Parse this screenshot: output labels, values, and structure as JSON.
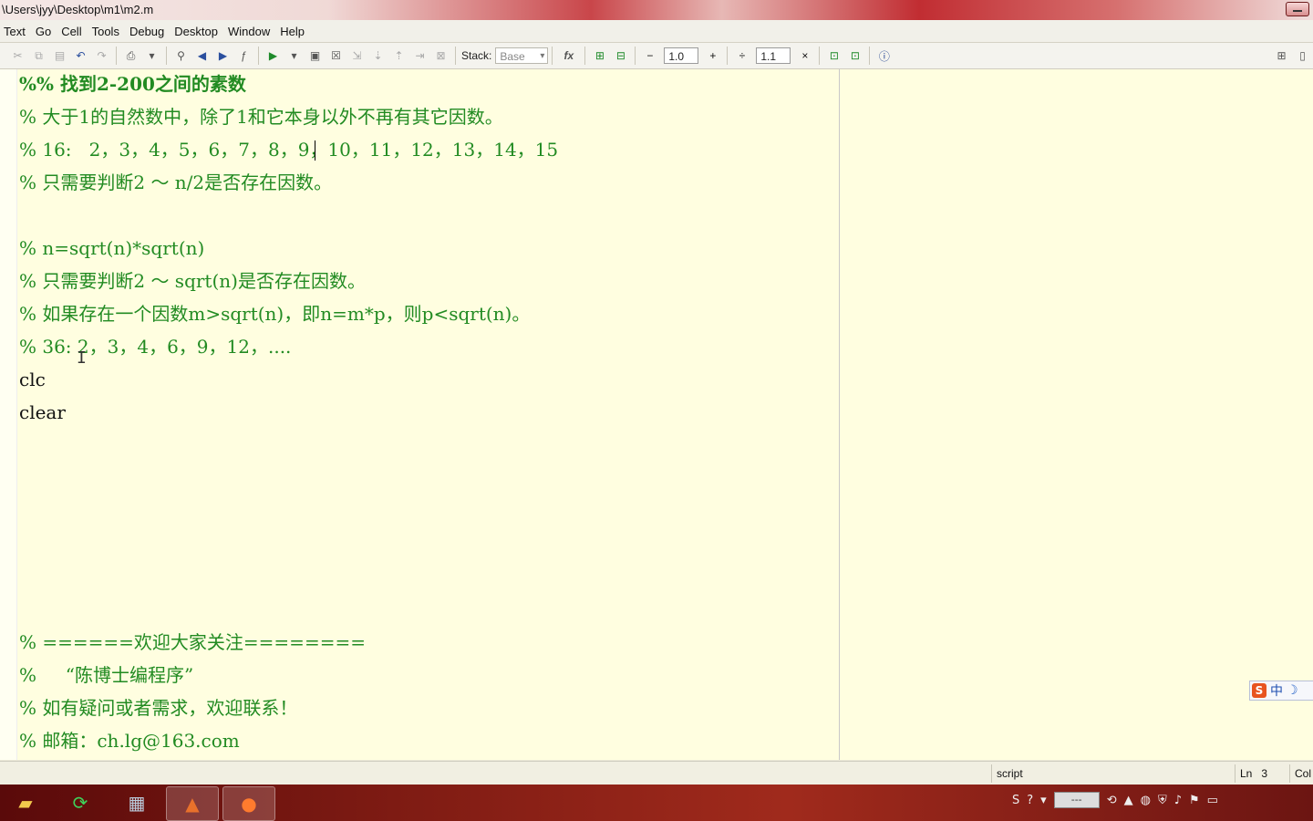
{
  "window": {
    "title_path": "\\Users\\jyy\\Desktop\\m1\\m2.m"
  },
  "menu": [
    "Text",
    "Go",
    "Cell",
    "Tools",
    "Debug",
    "Desktop",
    "Window",
    "Help"
  ],
  "toolbar": {
    "stack_label": "Stack:",
    "stack_value": "Base",
    "fx_label": "fx",
    "cell_increment": "1.0",
    "cell_divide": "1.1",
    "minus": "−",
    "plus": "+",
    "divide": "÷",
    "times": "×"
  },
  "editor": {
    "lines": [
      {
        "text": "%% 找到2-200之间的素数",
        "kind": "cell-title"
      },
      {
        "text": "% 大于1的自然数中，除了1和它本身以外不再有其它因数。",
        "kind": "comment"
      },
      {
        "text": "% 16:   2，3，4，5，6，7，8，9，10，11，12，13，14，15",
        "kind": "comment"
      },
      {
        "text": "% 只需要判断2 ～ n/2是否存在因数。",
        "kind": "comment"
      },
      {
        "text": "",
        "kind": "blank"
      },
      {
        "text": "% n=sqrt(n)*sqrt(n)",
        "kind": "comment"
      },
      {
        "text": "% 只需要判断2 ～ sqrt(n)是否存在因数。",
        "kind": "comment"
      },
      {
        "text": "% 如果存在一个因数m>sqrt(n)，即n=m*p，则p<sqrt(n)。",
        "kind": "comment"
      },
      {
        "text": "% 36: 2，3，4，6，9，12，....",
        "kind": "comment"
      },
      {
        "text": "clc",
        "kind": "code"
      },
      {
        "text": "clear",
        "kind": "code"
      },
      {
        "text": "% ======欢迎大家关注========",
        "kind": "comment"
      },
      {
        "text": "%     “陈博士编程序”",
        "kind": "comment"
      },
      {
        "text": "% 如有疑问或者需求，欢迎联系！",
        "kind": "comment"
      },
      {
        "text": "% 邮箱：ch.lg@163.com",
        "kind": "comment"
      }
    ]
  },
  "ime": {
    "brand": "S",
    "mode": "中",
    "moon": "☽"
  },
  "status": {
    "mode": "script",
    "ln_label": "Ln",
    "ln_value": "3",
    "col_label": "Col"
  },
  "tray": {
    "input_text": "---"
  },
  "colors": {
    "comment": "#228b22",
    "code": "#111111",
    "editor_bg": "#fffee0"
  }
}
